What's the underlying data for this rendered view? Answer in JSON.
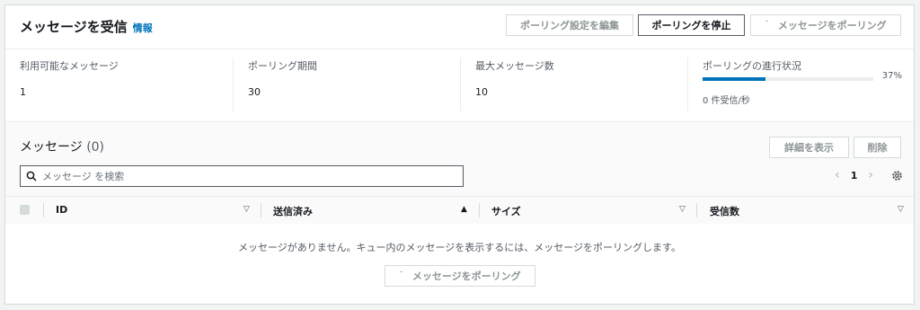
{
  "header": {
    "title": "メッセージを受信",
    "info": "情報",
    "edit_button": "ポーリング設定を編集",
    "stop_button": "ポーリングを停止",
    "poll_button": "メッセージをポーリング"
  },
  "stats": {
    "available_label": "利用可能なメッセージ",
    "available_value": "1",
    "duration_label": "ポーリング期間",
    "duration_value": "30",
    "max_label": "最大メッセージ数",
    "max_value": "10",
    "progress_label": "ポーリングの進行状況",
    "progress_percent": "37%",
    "progress_fraction": 0.37,
    "rate_text": "0 件受信/秒"
  },
  "messages": {
    "title": "メッセージ",
    "count": "(0)",
    "details_button": "詳細を表示",
    "delete_button": "削除",
    "search_placeholder": "メッセージ を検索",
    "page": "1",
    "columns": [
      "ID",
      "送信済み",
      "サイズ",
      "受信数"
    ],
    "empty_text": "メッセージがありません。キュー内のメッセージを表示するには、メッセージをポーリングします。",
    "poll_button": "メッセージをポーリング"
  },
  "colors": {
    "accent": "#0073bb",
    "border": "#d5dbdb"
  },
  "icons": [
    "search-icon",
    "chevron-left-icon",
    "chevron-right-icon",
    "gear-icon",
    "sort-down-icon",
    "sort-up-icon",
    "spinner-icon"
  ]
}
